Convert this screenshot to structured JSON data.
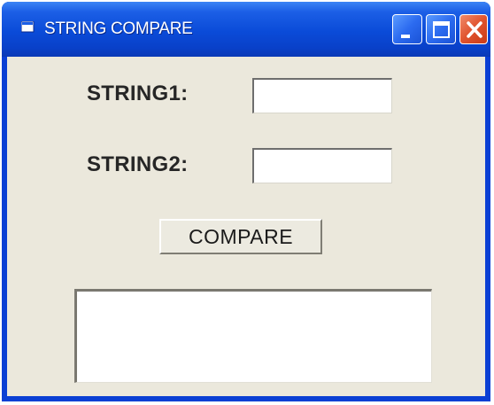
{
  "window": {
    "title": "STRING COMPARE",
    "icon": "app-icon",
    "controls": [
      "minimize-icon",
      "maximize-icon",
      "close-icon"
    ]
  },
  "form": {
    "string1": {
      "label": "STRING1:",
      "value": "",
      "placeholder": ""
    },
    "string2": {
      "label": "STRING2:",
      "value": "",
      "placeholder": ""
    },
    "compare_button": {
      "label": "COMPARE"
    },
    "output": {
      "value": ""
    }
  },
  "colors": {
    "titlebar": "#0a4bd8",
    "client_background": "#ebe8dc",
    "close_button": "#e0532e"
  }
}
